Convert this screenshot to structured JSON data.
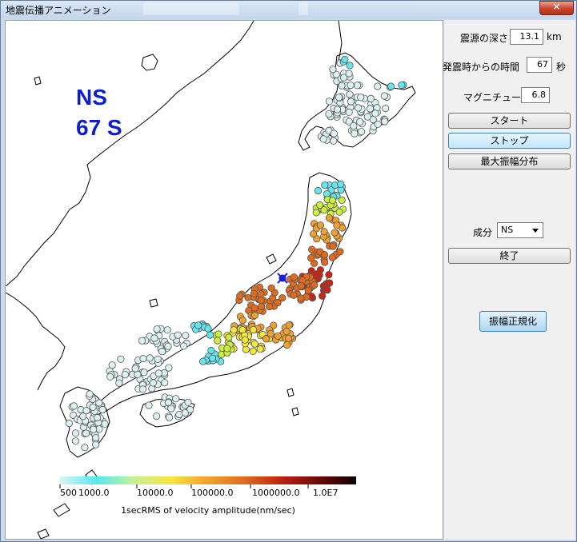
{
  "window": {
    "title": "地震伝播アニメーション",
    "close_label": "✕"
  },
  "overlay": {
    "component": "NS",
    "time": "67 S"
  },
  "controls": {
    "depth": {
      "label": "震源の深さ",
      "value": "13.1",
      "unit": "km"
    },
    "elapsed": {
      "label": "発震時からの時間",
      "value": "67",
      "unit": "秒"
    },
    "magnitude": {
      "label": "マグニチュード",
      "value": "6.8"
    },
    "start_button": "スタート",
    "stop_button": "ストップ",
    "maxamp_button": "最大振幅分布",
    "component_label": "成分",
    "component_value": "NS",
    "exit_button": "終了",
    "normalize_button": "振幅正規化"
  },
  "colorbar": {
    "tick_labels": [
      "500",
      "1000.0",
      "10000.0",
      "100000.0",
      "1000000.0",
      "1.0E7"
    ],
    "caption": "1secRMS of velocity amplitude(nm/sec)",
    "colors": [
      "#d8f4f4",
      "#54e9ef",
      "#c8f09a",
      "#f6e63a",
      "#f2a22a",
      "#e06a1e",
      "#c01e12",
      "#6a0a08",
      "#100000"
    ]
  },
  "palette": {
    "land_outline": "#000000",
    "station_outline": "#555555",
    "low": "#ddf1f1",
    "cyan": "#67e5ee",
    "yellow_green": "#cbee3f",
    "yellow": "#f5e83a",
    "orange": "#f0a030",
    "dark_orange": "#e06a1e",
    "red": "#cc2412",
    "epicenter": "#1a1ae0"
  }
}
